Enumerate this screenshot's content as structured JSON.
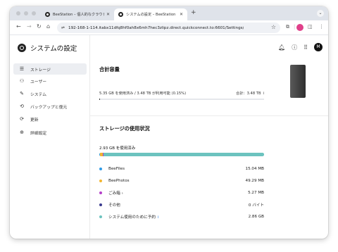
{
  "browser": {
    "tabs": [
      {
        "title": "BeeStation – 個人的なクラウド"
      },
      {
        "title": "システムの設定 – BeeStation"
      }
    ],
    "url": "192-168-1-114.itabx11dfq8hf0ah8x6mh7hec3zlipz.direct.quickconnect.to:6601/Settings/"
  },
  "app": {
    "title": "システムの設定",
    "avatar_letter": "M"
  },
  "sidebar": {
    "items": [
      {
        "label": "ストレージ",
        "icon": "storage-icon",
        "active": true
      },
      {
        "label": "ユーザー",
        "icon": "user-icon",
        "active": false
      },
      {
        "label": "システム",
        "icon": "wrench-icon",
        "active": false
      },
      {
        "label": "バックアップと復元",
        "icon": "backup-icon",
        "active": false
      },
      {
        "label": "更新",
        "icon": "update-icon",
        "active": false
      },
      {
        "label": "詳細設定",
        "icon": "advanced-icon",
        "active": false
      }
    ]
  },
  "capacity": {
    "heading": "合計容量",
    "used_text": "5.35 GB を使用済み / 3.48 TB が利用可能 (0.15%)",
    "total_text": "合計：3.48 TB",
    "used_fraction": 0.0015
  },
  "usage": {
    "heading": "ストレージの使用状況",
    "used_title": "2.93 GB を使用済み",
    "items": [
      {
        "label": "BeeFiles",
        "value": "15.04 MB",
        "color": "#2f9be6",
        "link": false,
        "info": false
      },
      {
        "label": "BeePhotos",
        "value": "49.29 MB",
        "color": "#f2b632",
        "link": false,
        "info": false
      },
      {
        "label": "ごみ箱",
        "value": "5.27 MB",
        "color": "#b43fc9",
        "link": true,
        "info": false
      },
      {
        "label": "その他",
        "value": "0 バイト",
        "color": "#3a3b8f",
        "link": false,
        "info": false
      },
      {
        "label": "システム使用のために予約",
        "value": "2.86 GB",
        "color": "#6cc3bf",
        "link": false,
        "info": true
      }
    ]
  }
}
